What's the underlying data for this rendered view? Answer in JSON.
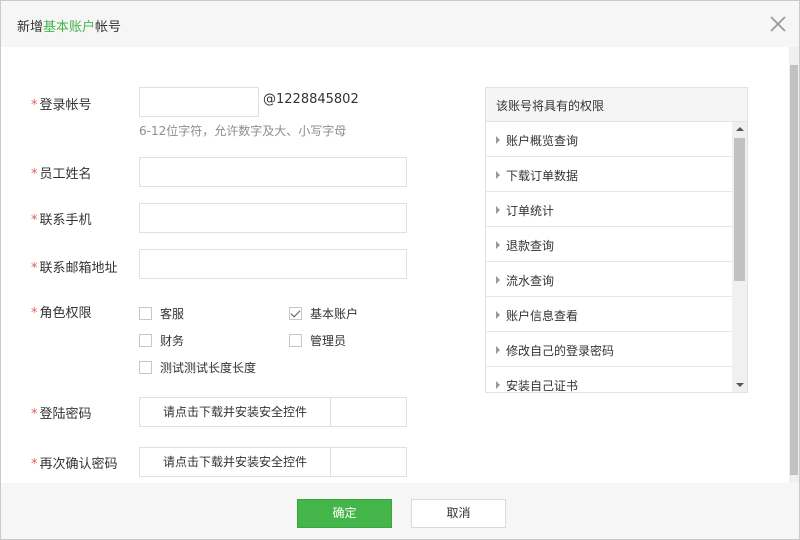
{
  "dialog": {
    "title_prefix": "新增",
    "title_highlight": "基本账户",
    "title_suffix": "帐号"
  },
  "form": {
    "account": {
      "label": "登录帐号",
      "value": "",
      "suffix": "@1228845802",
      "hint": "6-12位字符，允许数字及大、小写字母"
    },
    "staff_name": {
      "label": "员工姓名",
      "value": ""
    },
    "phone": {
      "label": "联系手机",
      "value": ""
    },
    "email": {
      "label": "联系邮箱地址",
      "value": ""
    },
    "role": {
      "label": "角色权限",
      "options": [
        {
          "label": "客服",
          "checked": false
        },
        {
          "label": "基本账户",
          "checked": true
        },
        {
          "label": "财务",
          "checked": false
        },
        {
          "label": "管理员",
          "checked": false
        },
        {
          "label": "测试测试长度长度",
          "checked": false
        }
      ]
    },
    "password": {
      "label": "登陆密码",
      "button_label": "请点击下载并安装安全控件"
    },
    "confirm_password": {
      "label": "再次确认密码",
      "button_label": "请点击下载并安装安全控件"
    },
    "required_mark": "*"
  },
  "permissions": {
    "title": "该账号将具有的权限",
    "items": [
      "账户概览查询",
      "下载订单数据",
      "订单统计",
      "退款查询",
      "流水查询",
      "账户信息查看",
      "修改自己的登录密码",
      "安装自己证书"
    ]
  },
  "footer": {
    "confirm_label": "确定",
    "cancel_label": "取消"
  },
  "colors": {
    "accent": "#44b549",
    "required": "#e15f63"
  }
}
